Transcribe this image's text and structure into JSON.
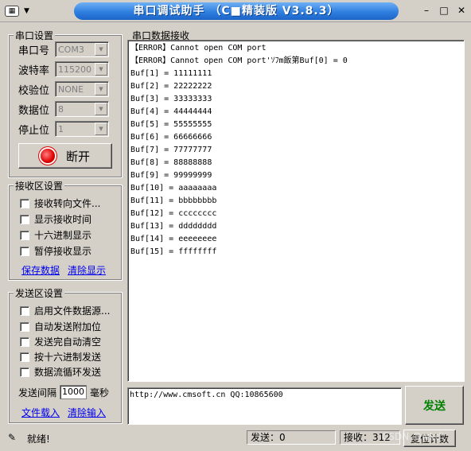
{
  "window": {
    "title": "串口调试助手 （C■精装版 V3.8.3）",
    "app_icon": "app-icon",
    "controls": [
      "minimize-icon",
      "maximize-icon",
      "close-icon"
    ]
  },
  "serial_settings": {
    "title": "串口设置",
    "port": {
      "label": "串口号",
      "value": "COM3"
    },
    "baud": {
      "label": "波特率",
      "value": "115200"
    },
    "parity": {
      "label": "校验位",
      "value": "NONE"
    },
    "databits": {
      "label": "数据位",
      "value": "8"
    },
    "stopbits": {
      "label": "停止位",
      "value": "1"
    },
    "connect_button": "断开"
  },
  "receive_settings": {
    "title": "接收区设置",
    "options": [
      "接收转向文件...",
      "显示接收时间",
      "十六进制显示",
      "暂停接收显示"
    ],
    "save_link": "保存数据",
    "clear_link": "清除显示"
  },
  "send_settings": {
    "title": "发送区设置",
    "options": [
      "启用文件数据源...",
      "自动发送附加位",
      "发送完自动清空",
      "按十六进制发送",
      "数据流循环发送"
    ],
    "interval_label": "发送间隔",
    "interval_value": "1000",
    "interval_unit": "毫秒",
    "file_link": "文件载入",
    "clear_link": "清除输入"
  },
  "receive_panel": {
    "title": "串口数据接收",
    "lines": [
      "【ERROR】Cannot open COM port",
      "【ERROR】Cannot open COM port'ｿﾌm飯第Buf[0] = 0",
      "Buf[1] = 11111111",
      "Buf[2] = 22222222",
      "Buf[3] = 33333333",
      "Buf[4] = 44444444",
      "Buf[5] = 55555555",
      "Buf[6] = 66666666",
      "Buf[7] = 77777777",
      "Buf[8] = 88888888",
      "Buf[9] = 99999999",
      "Buf[10] = aaaaaaaa",
      "Buf[11] = bbbbbbbb",
      "Buf[12] = cccccccc",
      "Buf[13] = dddddddd",
      "Buf[14] = eeeeeeee",
      "Buf[15] = ffffffff"
    ]
  },
  "send_panel": {
    "text": "http://www.cmsoft.cn QQ:10865600",
    "send_button": "发送"
  },
  "status_bar": {
    "ready": "就绪!",
    "sent": "发送：0",
    "received": "接收：312",
    "reset_button": "复位计数",
    "watermark": "CSDN @wkdt"
  }
}
